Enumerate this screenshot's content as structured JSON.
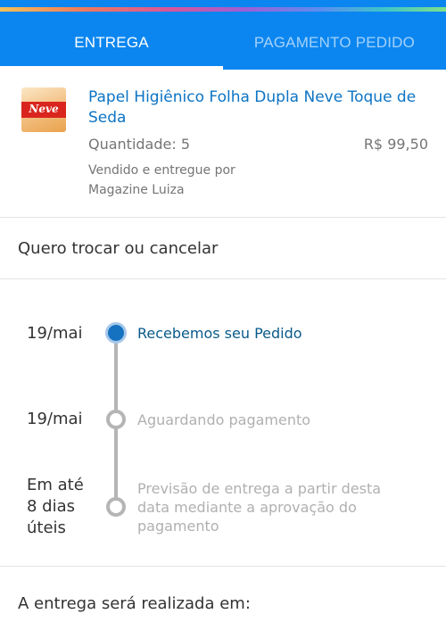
{
  "tabs": [
    {
      "label": "ENTREGA",
      "active": true
    },
    {
      "label": "PAGAMENTO PEDIDO",
      "active": false
    }
  ],
  "product": {
    "image_logo": "Neve",
    "title": "Papel Higiênico Folha Dupla Neve Toque de Seda",
    "quantity": "Quantidade: 5",
    "price": "R$ 99,50",
    "seller": "Vendido e entregue por Magazine Luiza"
  },
  "exchange_link": "Quero trocar ou cancelar",
  "timeline": [
    {
      "date": "19/mai",
      "label": "Recebemos seu Pedido",
      "status": "done"
    },
    {
      "date": "19/mai",
      "label": "Aguardando pagamento",
      "status": "pending"
    },
    {
      "date": "Em até 8 dias úteis",
      "label": "Previsão de entrega a partir desta data mediante a aprovação do pagamento",
      "status": "pending"
    }
  ],
  "delivery_heading": "A entrega será realizada em:",
  "colors": {
    "header_blue": "#0b86f0",
    "link_blue": "#0d74c4",
    "done_dot": "#1572c0",
    "pending_gray": "#b5b5b5"
  }
}
